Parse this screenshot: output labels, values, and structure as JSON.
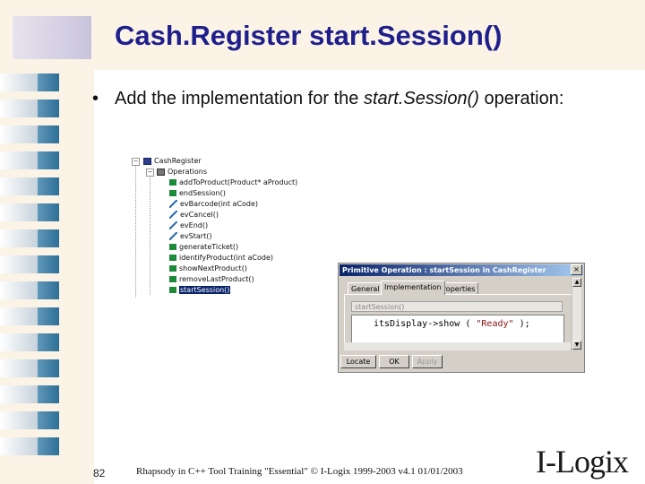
{
  "slide": {
    "title": "Cash.Register start.Session()",
    "bullet_lead": "Add the implementation for the ",
    "bullet_op": "start.Session()",
    "bullet_tail": " operation:",
    "page_number": "82",
    "footer": "Rhapsody in C++ Tool Training \"Essential\"  © I-Logix 1999-2003   v4.1  01/01/2003",
    "logo": "I-Logix"
  },
  "tree": {
    "root": "CashRegister",
    "folder": "Operations",
    "items": [
      {
        "label": "addToProduct(Product* aProduct)",
        "icon": "operation-icon"
      },
      {
        "label": "endSession()",
        "icon": "operation-icon"
      },
      {
        "label": "evBarcode(int aCode)",
        "icon": "event-reception-icon"
      },
      {
        "label": "evCancel()",
        "icon": "event-reception-icon"
      },
      {
        "label": "evEnd()",
        "icon": "event-reception-icon"
      },
      {
        "label": "evStart()",
        "icon": "event-reception-icon"
      },
      {
        "label": "generateTicket()",
        "icon": "operation-icon"
      },
      {
        "label": "identifyProduct(int aCode)",
        "icon": "operation-icon"
      },
      {
        "label": "showNextProduct()",
        "icon": "operation-icon"
      },
      {
        "label": "removeLastProduct()",
        "icon": "operation-icon"
      },
      {
        "label": "startSession()",
        "icon": "operation-icon",
        "selected": true
      }
    ]
  },
  "dialog": {
    "title": "Primitive Operation : startSession in CashRegister",
    "close": "×",
    "tabs": [
      "General",
      "Implementation",
      "Properties"
    ],
    "active_tab": "Implementation",
    "signature": "startSession()",
    "code_before": "itsDisplay->show ( ",
    "code_string": "\"Ready\"",
    "code_after": " );",
    "buttons": {
      "locate": "Locate",
      "ok": "OK",
      "apply": "Apply"
    }
  }
}
